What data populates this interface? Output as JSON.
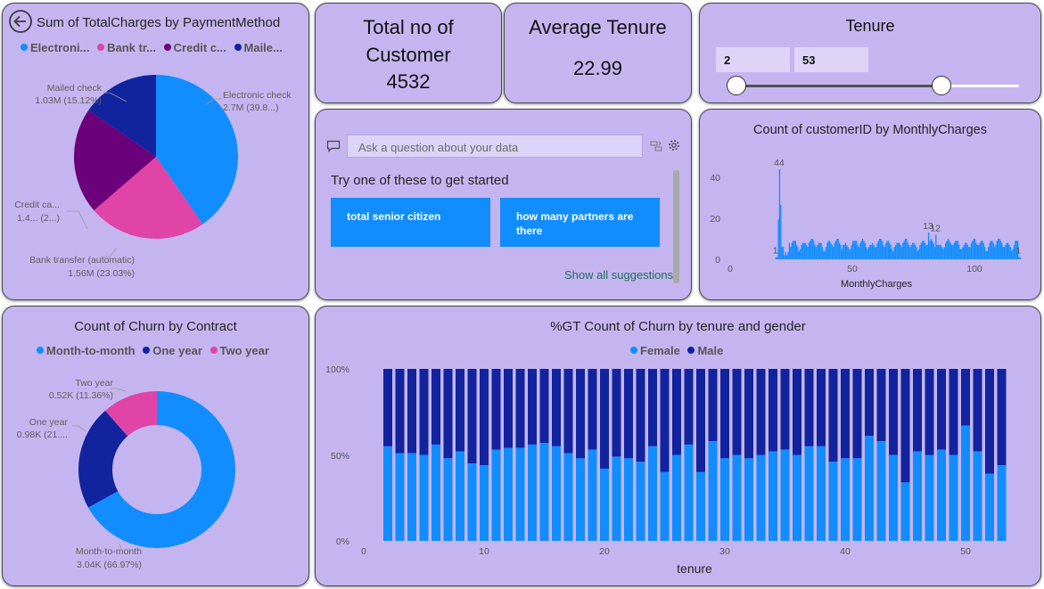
{
  "colors": {
    "card_bg": "#c4b5f0",
    "electronic": "#118dff",
    "bank": "#e044a7",
    "credit": "#6b007b",
    "mailed": "#12239e",
    "female": "#118dff",
    "male": "#12239e",
    "histogram": "#118dff"
  },
  "payment_card": {
    "back_icon": "back-arrow-icon",
    "title": "Sum of TotalCharges by PaymentMethod",
    "legend": [
      "Electroni...",
      "Bank tr...",
      "Credit c...",
      "Maile..."
    ],
    "labels": {
      "electronic_name": "Electronic check",
      "electronic_value": "2.7M (39.8...)",
      "mailed_name": "Mailed check",
      "mailed_value": "1.03M (15.12%)",
      "credit_name": "Credit ca...",
      "credit_value": "1.4... (2...)",
      "bank_name": "Bank transfer (automatic)",
      "bank_value": "1.56M (23.03%)"
    }
  },
  "kpi_customers": {
    "title_line1": "Total no of",
    "title_line2": "Customer",
    "value": "4532"
  },
  "kpi_tenure": {
    "title": "Average Tenure",
    "value": "22.99"
  },
  "tenure_slicer": {
    "title": "Tenure",
    "min_value": "2",
    "max_value": "53",
    "range_min": 0,
    "range_max": 72
  },
  "qa": {
    "chat_icon": "chat-icon",
    "placeholder": "Ask a question about your data",
    "prompt": "Try one of these to get started",
    "suggestions": [
      "total senior citizen",
      "how many partners are there"
    ],
    "show_all": "Show all suggestions",
    "settings_icon": "gear-icon",
    "convert_icon": "convert-visual-icon"
  },
  "churn_contract": {
    "title": "Count of Churn by Contract",
    "legend": [
      "Month-to-month",
      "One year",
      "Two year"
    ],
    "labels": {
      "month_name": "Month-to-month",
      "month_value": "3.04K (66.97%)",
      "one_name": "One year",
      "one_value": "0.98K (21....",
      "two_name": "Two year",
      "two_value": "0.52K (11.36%)"
    }
  },
  "hist_card": {
    "title": "Count of customerID by MonthlyCharges"
  },
  "churn_tenure_card": {
    "title": "%GT Count of Churn by tenure and gender"
  },
  "chart_data": [
    {
      "type": "pie",
      "title": "Sum of TotalCharges by PaymentMethod",
      "categories": [
        "Electronic check",
        "Bank transfer (automatic)",
        "Credit card (automatic)",
        "Mailed check"
      ],
      "values": [
        2.7,
        1.56,
        1.4,
        1.03
      ],
      "percent": [
        39.8,
        23.03,
        22.05,
        15.12
      ],
      "unit": "M"
    },
    {
      "type": "pie",
      "title": "Count of Churn by Contract",
      "categories": [
        "Month-to-month",
        "One year",
        "Two year"
      ],
      "values": [
        3040,
        980,
        520
      ],
      "percent": [
        66.97,
        21.67,
        11.36
      ]
    },
    {
      "type": "bar",
      "title": "Count of customerID by MonthlyCharges",
      "xlabel": "MonthlyCharges",
      "x_ticks": [
        "0",
        "50",
        "100"
      ],
      "y_ticks": [
        "0",
        "20",
        "40"
      ],
      "xlim": [
        0,
        120
      ],
      "ylim": [
        0,
        46
      ],
      "data_labels": [
        "44",
        "1",
        "13",
        "12",
        "1"
      ],
      "peak": {
        "x": 20,
        "y": 44
      },
      "visible_labels": [
        {
          "x": 20.05,
          "y": 44,
          "label": "44"
        },
        {
          "x": 18.5,
          "y": 1,
          "label": "1"
        },
        {
          "x": 81,
          "y": 13,
          "label": "13"
        },
        {
          "x": 84,
          "y": 12,
          "label": "12"
        },
        {
          "x": 118,
          "y": 1,
          "label": "1"
        }
      ]
    },
    {
      "type": "bar",
      "stacked_percent": true,
      "title": "%GT Count of Churn by tenure and gender",
      "xlabel": "tenure",
      "x_ticks": [
        "0",
        "10",
        "20",
        "30",
        "40",
        "50"
      ],
      "y_ticks": [
        "0%",
        "50%",
        "100%"
      ],
      "legend": [
        "Female",
        "Male"
      ],
      "tenure": [
        2,
        3,
        4,
        5,
        6,
        7,
        8,
        9,
        10,
        11,
        12,
        13,
        14,
        15,
        16,
        17,
        18,
        19,
        20,
        21,
        22,
        23,
        24,
        25,
        26,
        27,
        28,
        29,
        30,
        31,
        32,
        33,
        34,
        35,
        36,
        37,
        38,
        39,
        40,
        41,
        42,
        43,
        44,
        45,
        46,
        47,
        48,
        49,
        50,
        51,
        52,
        53
      ],
      "female_pct": [
        55,
        51,
        51,
        50,
        56,
        48,
        52,
        45,
        44,
        53,
        54,
        54,
        56,
        57,
        55,
        51,
        48,
        53,
        42,
        49,
        48,
        46,
        55,
        40,
        50,
        56,
        40,
        58,
        48,
        50,
        48,
        50,
        52,
        53,
        50,
        55,
        55,
        46,
        48,
        48,
        61,
        58,
        50,
        34,
        52,
        50,
        53,
        50,
        67,
        52,
        39,
        44,
        50
      ]
    }
  ]
}
